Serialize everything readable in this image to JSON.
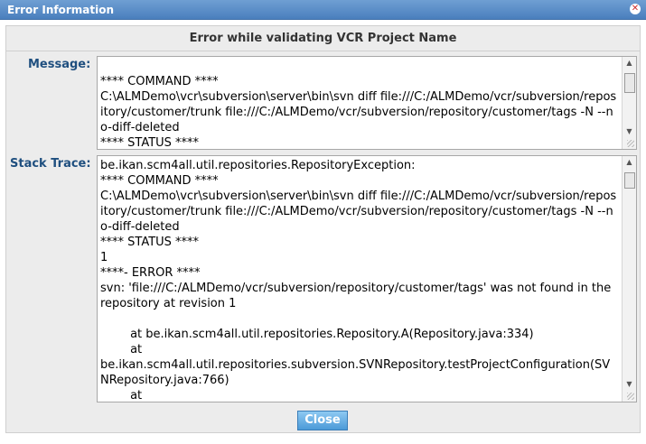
{
  "window": {
    "title": "Error Information",
    "close_icon": "close-icon"
  },
  "dialog": {
    "heading": "Error while validating VCR Project Name",
    "message_label": "Message:",
    "message_text": "\n**** COMMAND ****\nC:\\ALMDemo\\vcr\\subversion\\server\\bin\\svn diff file:///C:/ALMDemo/vcr/subversion/repository/customer/trunk file:///C:/ALMDemo/vcr/subversion/repository/customer/tags -N --no-diff-deleted\n**** STATUS ****",
    "stack_label": "Stack Trace:",
    "stack_text": "be.ikan.scm4all.util.repositories.RepositoryException:\n**** COMMAND ****\nC:\\ALMDemo\\vcr\\subversion\\server\\bin\\svn diff file:///C:/ALMDemo/vcr/subversion/repository/customer/trunk file:///C:/ALMDemo/vcr/subversion/repository/customer/tags -N --no-diff-deleted\n**** STATUS ****\n1\n****- ERROR ****\nsvn: 'file:///C:/ALMDemo/vcr/subversion/repository/customer/tags' was not found in the repository at revision 1\n\n        at be.ikan.scm4all.util.repositories.Repository.A(Repository.java:334)\n        at\nbe.ikan.scm4all.util.repositories.subversion.SVNRepository.testProjectConfiguration(SVNRepository.java:766)\n        at",
    "close_button": "Close"
  },
  "colors": {
    "title_bar": "#5a8cc8",
    "label": "#1f4f7f",
    "button": "#5ba8e0"
  }
}
